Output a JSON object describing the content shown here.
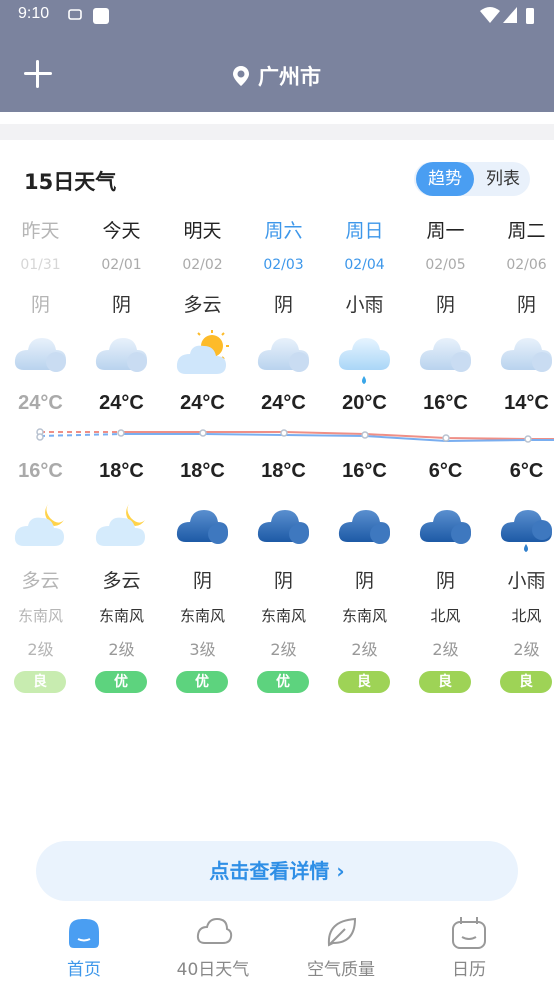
{
  "status_bar": {
    "time": "9:10"
  },
  "header": {
    "city": "广州市"
  },
  "forecast": {
    "title": "15日天气",
    "view_toggle": {
      "trend": "趋势",
      "list": "列表"
    },
    "days": [
      {
        "day": "昨天",
        "date": "01/31",
        "day_cond": "阴",
        "day_icon": "overcast-icon",
        "high": "24°C",
        "low": "16°C",
        "night_icon": "partly-cloudy-night-icon",
        "night_cond": "多云",
        "wind": "东南风",
        "level": "2级",
        "aq": "良",
        "aq_color": "#c8ecb0"
      },
      {
        "day": "今天",
        "date": "02/01",
        "day_cond": "阴",
        "day_icon": "overcast-icon",
        "high": "24°C",
        "low": "18°C",
        "night_icon": "partly-cloudy-night-icon",
        "night_cond": "多云",
        "wind": "东南风",
        "level": "2级",
        "aq": "优",
        "aq_color": "#5dd37e"
      },
      {
        "day": "明天",
        "date": "02/02",
        "day_cond": "多云",
        "day_icon": "partly-cloudy-day-icon",
        "high": "24°C",
        "low": "18°C",
        "night_icon": "overcast-night-icon",
        "night_cond": "阴",
        "wind": "东南风",
        "level": "3级",
        "aq": "优",
        "aq_color": "#5dd37e"
      },
      {
        "day": "周六",
        "date": "02/03",
        "day_cond": "阴",
        "day_icon": "overcast-icon",
        "high": "24°C",
        "low": "18°C",
        "night_icon": "overcast-night-icon",
        "night_cond": "阴",
        "wind": "东南风",
        "level": "2级",
        "aq": "优",
        "aq_color": "#5dd37e"
      },
      {
        "day": "周日",
        "date": "02/04",
        "day_cond": "小雨",
        "day_icon": "light-rain-icon",
        "high": "20°C",
        "low": "16°C",
        "night_icon": "overcast-night-icon",
        "night_cond": "阴",
        "wind": "东南风",
        "level": "2级",
        "aq": "良",
        "aq_color": "#9ed356"
      },
      {
        "day": "周一",
        "date": "02/05",
        "day_cond": "阴",
        "day_icon": "overcast-icon",
        "high": "16°C",
        "low": "6°C",
        "night_icon": "overcast-night-icon",
        "night_cond": "阴",
        "wind": "北风",
        "level": "2级",
        "aq": "良",
        "aq_color": "#9ed356"
      },
      {
        "day": "周二",
        "date": "02/06",
        "day_cond": "阴",
        "day_icon": "overcast-icon",
        "high": "14°C",
        "low": "6°C",
        "night_icon": "light-rain-night-icon",
        "night_cond": "小雨",
        "wind": "北风",
        "level": "2级",
        "aq": "良",
        "aq_color": "#9ed356"
      }
    ]
  },
  "detail_button": {
    "label": "点击查看详情"
  },
  "bottom_nav": [
    {
      "label": "首页",
      "icon": "home-icon",
      "active": true
    },
    {
      "label": "40日天气",
      "icon": "cloud-icon",
      "active": false
    },
    {
      "label": "空气质量",
      "icon": "leaf-icon",
      "active": false
    },
    {
      "label": "日历",
      "icon": "calendar-icon",
      "active": false
    }
  ],
  "colors": {
    "header_bg": "#7b839e",
    "accent": "#3d97ea",
    "high_line": "#ef8f86",
    "low_line": "#79aef0"
  }
}
